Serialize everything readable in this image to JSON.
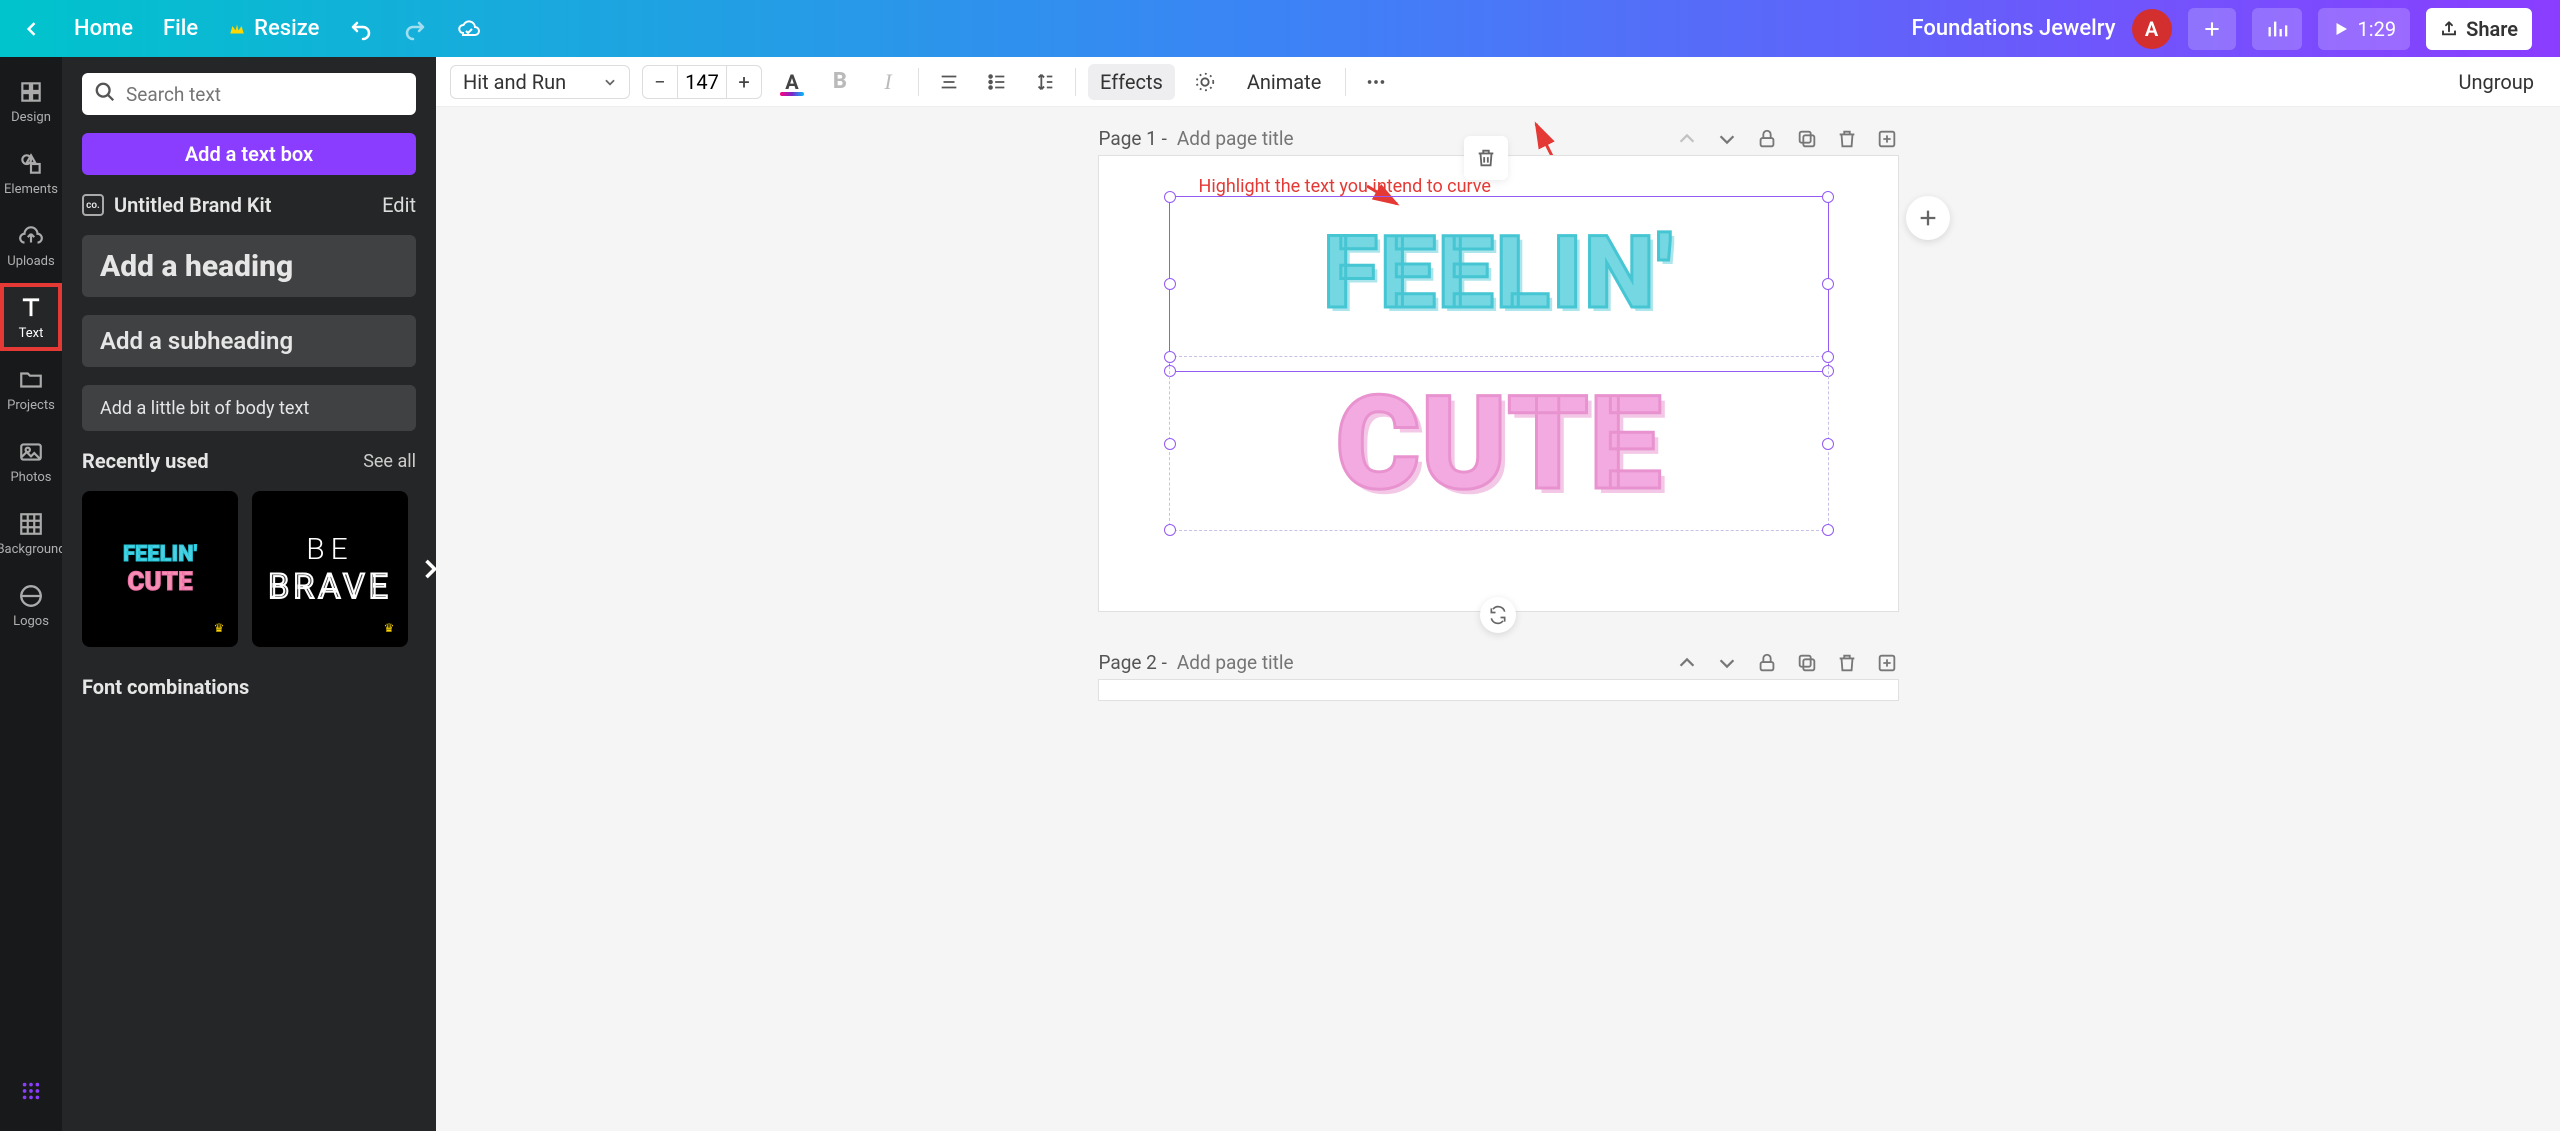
{
  "topbar": {
    "home": "Home",
    "file": "File",
    "resize": "Resize",
    "doc_title": "Foundations Jewelry",
    "avatar_letter": "A",
    "duration": "1:29",
    "share": "Share"
  },
  "rail": {
    "items": [
      {
        "label": "Design"
      },
      {
        "label": "Elements"
      },
      {
        "label": "Uploads"
      },
      {
        "label": "Text"
      },
      {
        "label": "Projects"
      },
      {
        "label": "Photos"
      },
      {
        "label": "Background"
      },
      {
        "label": "Logos"
      }
    ]
  },
  "panel": {
    "search_placeholder": "Search text",
    "add_text_box": "Add a text box",
    "brand_kit": "Untitled Brand Kit",
    "edit": "Edit",
    "heading": "Add a heading",
    "subheading": "Add a subheading",
    "body": "Add a little bit of body text",
    "recently_used": "Recently used",
    "see_all": "See all",
    "font_combinations": "Font combinations",
    "recent1_line1": "FEELIN'",
    "recent1_line2": "CUTE",
    "recent2_line1": "BE",
    "recent2_line2": "BRAVE"
  },
  "toolbar": {
    "font_name": "Hit and Run",
    "font_size": "147",
    "minus": "−",
    "plus": "+",
    "effects": "Effects",
    "animate": "Animate",
    "ungroup": "Ungroup"
  },
  "annotation": {
    "highlight_text": "Highlight the text you intend to curve"
  },
  "pages": {
    "p1_label": "Page 1 -",
    "p2_label": "Page 2 -",
    "title_placeholder": "Add page title",
    "text_feelin": "FEELIN'",
    "text_cute": "CUTE"
  }
}
